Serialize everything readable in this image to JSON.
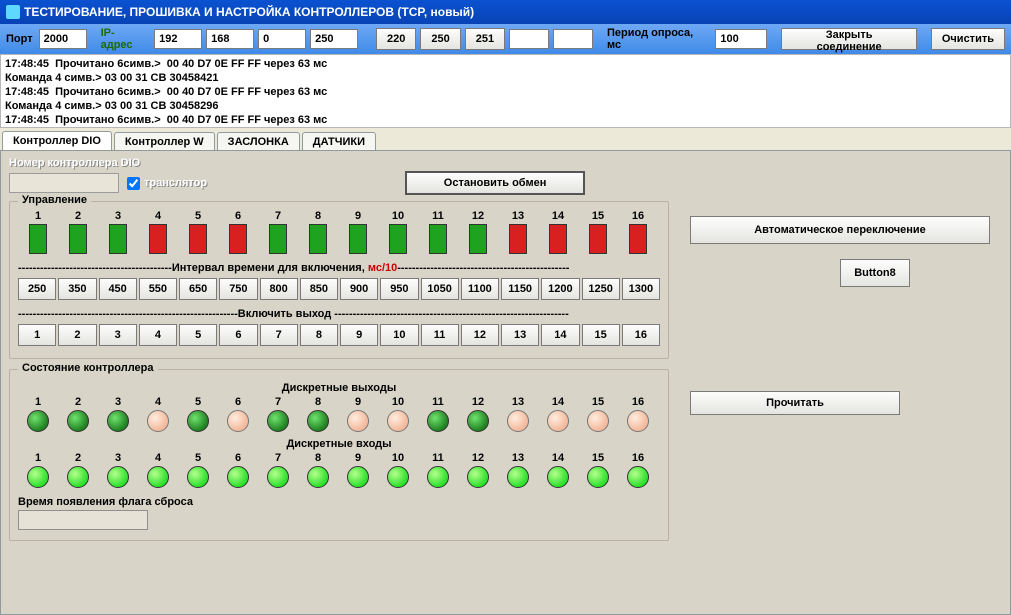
{
  "window": {
    "title": "ТЕСТИРОВАНИЕ, ПРОШИВКА И НАСТРОЙКА КОНТРОЛЛЕРОВ  (TCP, новый)"
  },
  "toolbar": {
    "port_label": "Порт",
    "port_value": "2000",
    "ip_label": "IP-адрес",
    "ip1": "192",
    "ip2": "168",
    "ip3": "0",
    "ip4": "250",
    "btn220": "220",
    "btn250": "250",
    "btn251": "251",
    "period_label": "Период опроса, мс",
    "period_value": "100",
    "close_conn": "Закрыть соединение",
    "clear": "Очистить"
  },
  "log": "17:48:45  Прочитано 6симв.>  00 40 D7 0E FF FF через 63 мс\nКоманда 4 симв.> 03 00 31 CB 30458421\n17:48:45  Прочитано 6симв.>  00 40 D7 0E FF FF через 63 мс\nКоманда 4 симв.> 03 00 31 CB 30458296\n17:48:45  Прочитано 6симв.>  00 40 D7 0E FF FF через 63 мс",
  "tabs": {
    "dio": "Контроллер DIO",
    "w": "Контроллер W",
    "zaslonka": "ЗАСЛОНКА",
    "datchiki": "ДАТЧИКИ"
  },
  "dio": {
    "ctl_num_label": "Номер контроллера DIO",
    "translator": "транслятор",
    "stop_exchange": "Остановить обмен",
    "control_legend": "Управление",
    "auto_switch": "Автоматическое переключение",
    "button8": "Button8",
    "interval_divider": "------------------------------------------Интервал времени для включения, ",
    "interval_accent": "мс/10",
    "interval_tail": "-----------------------------------------------",
    "enable_divider": "------------------------------------------------------------Включить  выход ----------------------------------------------------------------",
    "intervals": [
      "250",
      "350",
      "450",
      "550",
      "650",
      "750",
      "800",
      "850",
      "900",
      "950",
      "1050",
      "1100",
      "1150",
      "1200",
      "1250",
      "1300"
    ],
    "enable_nums": [
      "1",
      "2",
      "3",
      "4",
      "5",
      "6",
      "7",
      "8",
      "9",
      "10",
      "11",
      "12",
      "13",
      "14",
      "15",
      "16"
    ],
    "square_colors": [
      "g",
      "g",
      "g",
      "r",
      "r",
      "r",
      "g",
      "g",
      "g",
      "g",
      "g",
      "g",
      "r",
      "r",
      "r",
      "r"
    ],
    "state_legend": "Состояние контроллера",
    "disc_out": "Дискретные выходы",
    "disc_in": "Дискретные входы",
    "out_colors": [
      "g",
      "g",
      "g",
      "p",
      "g",
      "p",
      "g",
      "g",
      "p",
      "p",
      "g",
      "g",
      "p",
      "p",
      "p",
      "p"
    ],
    "in_all_bright": true,
    "reset_label": "Время появления флага сброса",
    "read": "Прочитать"
  }
}
